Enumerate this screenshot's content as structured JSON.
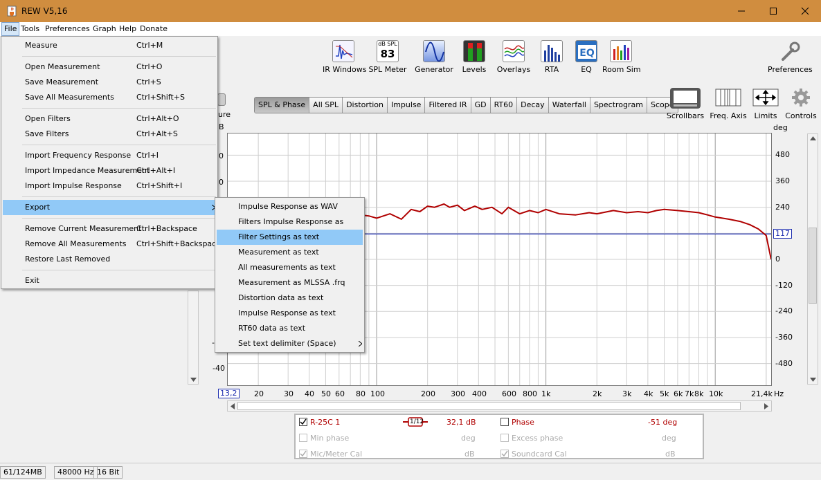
{
  "window": {
    "title": "REW V5,16",
    "icon": "java-cup-icon"
  },
  "menubar": [
    "File",
    "Tools",
    "Preferences",
    "Graph",
    "Help",
    "Donate"
  ],
  "toolbar": [
    {
      "label": "IR Windows",
      "icon": "ir-windows-icon"
    },
    {
      "label": "SPL Meter",
      "icon": "spl-meter-icon",
      "badge_top": "dB SPL",
      "badge_value": "83"
    },
    {
      "label": "Generator",
      "icon": "generator-icon"
    },
    {
      "label": "Levels",
      "icon": "levels-icon"
    },
    {
      "label": "Overlays",
      "icon": "overlays-icon"
    },
    {
      "label": "RTA",
      "icon": "rta-icon"
    },
    {
      "label": "EQ",
      "icon": "eq-icon"
    },
    {
      "label": "Room Sim",
      "icon": "room-sim-icon"
    },
    {
      "label": "Preferences",
      "icon": "wrench-icon"
    }
  ],
  "graph_tabs": [
    "SPL & Phase",
    "All SPL",
    "Distortion",
    "Impulse",
    "Filtered IR",
    "GD",
    "RT60",
    "Decay",
    "Waterfall",
    "Spectrogram",
    "Scope"
  ],
  "selected_tab": "SPL & Phase",
  "graph_tools": [
    {
      "label": "Scrollbars",
      "icon": "scrollbars-icon"
    },
    {
      "label": "Freq. Axis",
      "icon": "freq-axis-icon"
    },
    {
      "label": "Limits",
      "icon": "limits-icon"
    },
    {
      "label": "Controls",
      "icon": "gear-icon"
    }
  ],
  "partial_labels": {
    "measure_frag": "ure",
    "unit_frag": "B",
    "y0": "0",
    "y1": "0",
    "y_low": "-40",
    "y_tick_frag": "-"
  },
  "chart_data": {
    "type": "line",
    "right_axis_unit": "deg",
    "right_ticks": [
      "480",
      "360",
      "240",
      "117",
      "0",
      "-120",
      "-240",
      "-360",
      "-480"
    ],
    "phase_cursor": "117",
    "x_axis_unit": "Hz",
    "x_ticks": [
      "13,2",
      "20",
      "30",
      "40",
      "50",
      "60",
      "80",
      "100",
      "200",
      "300",
      "400",
      "600",
      "800",
      "1k",
      "2k",
      "3k",
      "4k",
      "5k",
      "6k",
      "7k",
      "8k",
      "10k",
      "21,4k"
    ],
    "x_range_hz": [
      13.2,
      21400
    ],
    "series": [
      {
        "name": "R-25C 1",
        "color": "#b00000",
        "x": [
          80,
          90,
          100,
          120,
          140,
          160,
          180,
          200,
          220,
          250,
          270,
          300,
          330,
          380,
          420,
          480,
          550,
          600,
          700,
          800,
          900,
          1000,
          1200,
          1500,
          1800,
          2000,
          2500,
          3000,
          3500,
          4000,
          4500,
          5000,
          6000,
          7000,
          8000,
          9000,
          10000,
          11000,
          12000,
          14000,
          16000,
          18000,
          20000,
          21400
        ],
        "y_phase_deg": [
          205,
          200,
          190,
          210,
          185,
          230,
          220,
          245,
          240,
          255,
          240,
          250,
          225,
          245,
          230,
          240,
          210,
          240,
          210,
          225,
          215,
          230,
          210,
          205,
          215,
          210,
          225,
          215,
          220,
          215,
          225,
          230,
          225,
          220,
          215,
          205,
          195,
          190,
          185,
          175,
          160,
          140,
          110,
          0
        ]
      }
    ]
  },
  "legend": {
    "row1": {
      "name": "R-25C 1",
      "smoothing": "1/12",
      "value": "32,1 dB",
      "name2": "Phase",
      "value2": "-51 deg",
      "color": "#b00000"
    },
    "row2": {
      "name": "Min phase",
      "unit": "deg",
      "name2": "Excess phase",
      "unit2": "deg"
    },
    "row3": {
      "name": "Mic/Meter Cal",
      "unit": "dB",
      "name2": "Soundcard Cal",
      "unit2": "dB"
    }
  },
  "status": {
    "memory": "61/124MB",
    "rate": "48000 Hz",
    "bits": "16 Bit"
  },
  "file_menu": [
    {
      "label": "Measure",
      "shortcut": "Ctrl+M"
    },
    {
      "label": "Open Measurement",
      "shortcut": "Ctrl+O"
    },
    {
      "label": "Save Measurement",
      "shortcut": "Ctrl+S"
    },
    {
      "label": "Save All Measurements",
      "shortcut": "Ctrl+Shift+S"
    },
    {
      "label": "Open Filters",
      "shortcut": "Ctrl+Alt+O"
    },
    {
      "label": "Save Filters",
      "shortcut": "Ctrl+Alt+S"
    },
    {
      "label": "Import Frequency Response",
      "shortcut": "Ctrl+I"
    },
    {
      "label": "Import Impedance Measurement",
      "shortcut": "Ctrl+Alt+I"
    },
    {
      "label": "Import Impulse Response",
      "shortcut": "Ctrl+Shift+I"
    },
    {
      "label": "Export",
      "shortcut": ""
    },
    {
      "label": "Remove Current Measurement",
      "shortcut": "Ctrl+Backspace"
    },
    {
      "label": "Remove All Measurements",
      "shortcut": "Ctrl+Shift+Backspace"
    },
    {
      "label": "Restore Last Removed",
      "shortcut": ""
    },
    {
      "label": "Exit",
      "shortcut": ""
    }
  ],
  "export_menu": [
    "Impulse Response as WAV",
    "Filters Impulse Response as WAV",
    "Filter Settings as text",
    "Measurement as text",
    "All measurements as text",
    "Measurement as MLSSA .frq",
    "Distortion data as text",
    "Impulse Response as text",
    "RT60 data as text",
    "Set text delimiter (Space)"
  ],
  "highlighted_export_item": "Filter Settings as text"
}
